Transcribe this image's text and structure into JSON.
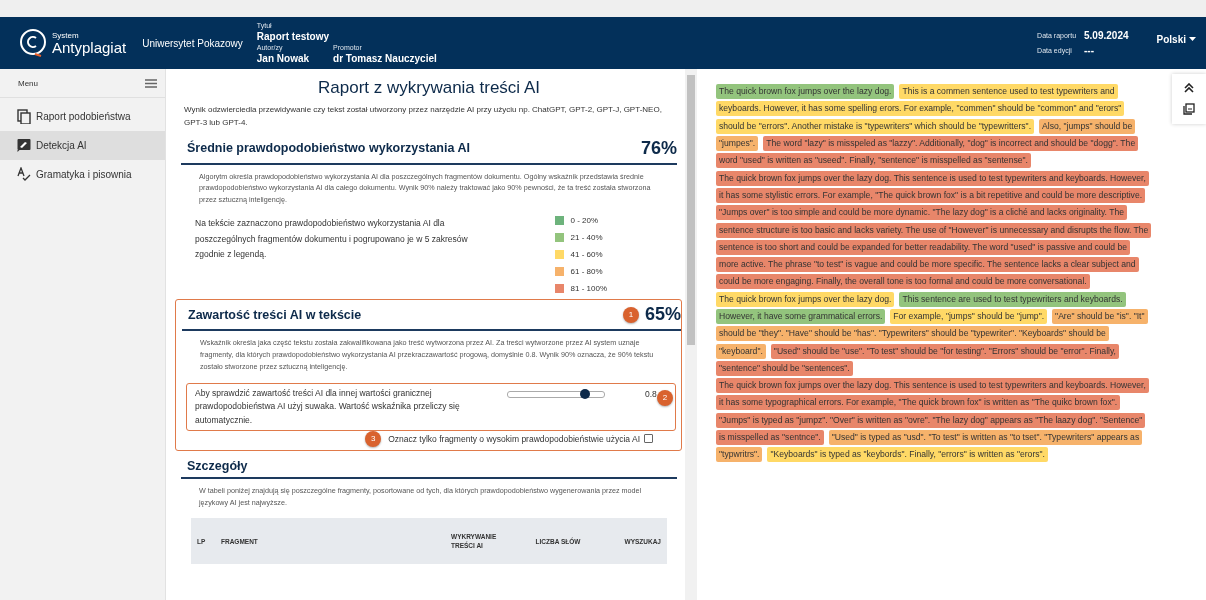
{
  "header": {
    "logo_small": "System",
    "logo": "Antyplagiat",
    "institution": "Uniwersytet Pokazowy",
    "title_label": "Tytuł",
    "title": "Raport testowy",
    "author_label": "Autor/zy",
    "author": "Jan Nowak",
    "promoter_label": "Promotor",
    "promoter": "dr Tomasz Nauczyciel",
    "report_date_label": "Data raportu",
    "report_date": "5.09.2024",
    "edit_date_label": "Data edycji",
    "edit_date": "---",
    "language": "Polski"
  },
  "sidebar": {
    "menu_label": "Menu",
    "items": [
      {
        "label": "Raport podobieństwa",
        "kind": "copy",
        "selected": false
      },
      {
        "label": "Detekcja AI",
        "kind": "ai",
        "selected": true
      },
      {
        "label": "Gramatyka i pisownia",
        "kind": "spell",
        "selected": false
      }
    ]
  },
  "report": {
    "title": "Raport z wykrywania treści AI",
    "intro": "Wynik odzwierciedla przewidywanie czy tekst został utworzony przez narzędzie AI przy użyciu np. ChatGPT, GPT-2, GPT-J, GPT-NEO, GPT-3 lub GPT-4.",
    "average": {
      "heading": "Średnie prawdopodobieństwo wykorzystania AI",
      "value": "76%",
      "description": "Algorytm określa prawdopodobieństwo wykorzystania AI dla poszczególnych fragmentów dokumentu. Ogólny wskaźnik przedstawia średnie prawdopodobieństwo wykorzystania AI dla całego dokumentu. Wynik 90% należy traktować jako 90% pewności, że ta treść została stworzona przez sztuczną inteligencję.",
      "legend_text": "Na tekście zaznaczono prawdopodobieństwo wykorzystania AI dla poszczególnych fragmentów dokumentu i pogrupowano je w 5 zakresów zgodnie z legendą.",
      "legend": [
        {
          "label": "0 - 20%",
          "color": "#6db37c"
        },
        {
          "label": "21 - 40%",
          "color": "#93c47d"
        },
        {
          "label": "41 - 60%",
          "color": "#ffd966"
        },
        {
          "label": "61 - 80%",
          "color": "#f6b26b"
        },
        {
          "label": "81 - 100%",
          "color": "#e8866a"
        }
      ]
    },
    "content": {
      "callout": "1",
      "heading": "Zawartość treści AI w tekście",
      "value": "65%",
      "description": "Wskaźnik określa jaka część tekstu została zakwalifikowana jako treść wytworzona przez AI. Za treści wytworzone przez AI system uznaje fragmenty, dla których prawdopodobieństwo wykorzystania AI przekraczawartość progową, domyślnie 0.8. Wynik 90% oznacza, że 90% tekstu zostało stworzone przez sztuczną inteligencję.",
      "slider": {
        "callout": "2",
        "text": "Aby sprawdzić zawartość treści AI dla innej wartości granicznej prawdopodobieństwa AI użyj suwaka. Wartość wskaźnika przeliczy się automatycznie.",
        "level": 0.8,
        "reading": "0.8"
      },
      "checkbox": {
        "callout": "3",
        "label": "Oznacz tylko fragmenty o wysokim prawdopodobieństwie użycia AI",
        "checked": false
      }
    },
    "details": {
      "heading": "Szczegóły",
      "description": "W tabeli poniżej znajdują się poszczególne fragmenty, posortowane od tych, dla których prawdopodobieństwo wygenerowania przez model językowy AI jest najwyższe.",
      "columns": [
        "LP",
        "FRAGMENT",
        "WYKRYWANIE TREŚCI AI",
        "LICZBA SŁÓW",
        "WYSZUKAJ"
      ]
    }
  },
  "document": {
    "lines": [
      {
        "fragments": [
          {
            "text": "The quick brown fox jumps over the lazy dog.",
            "color": "#93c47d"
          },
          {
            "text": "This is a commen sentence used to test typewriters and",
            "color": "#ffd966"
          }
        ]
      },
      {
        "fragments": [
          {
            "text": "keyboards. However, it has some spelling erors. For example, \"commen\" should be \"common\" and \"erors\"",
            "color": "#ffd966"
          }
        ]
      },
      {
        "fragments": [
          {
            "text": "should be \"errors\". Another mistake is \"typewriters\" which should be \"typewritters\".",
            "color": "#ffd966"
          },
          {
            "text": "Also, \"jumps\" should be",
            "color": "#f6b26b"
          }
        ]
      },
      {
        "fragments": [
          {
            "text": "\"jumpes\".",
            "color": "#f6b26b"
          },
          {
            "text": "The word \"lazy\" is misspeled as \"lazzy\". Additionally, \"dog\" is incorrect and should be \"dogg\". The",
            "color": "#e8866a"
          }
        ]
      },
      {
        "fragments": [
          {
            "text": "word \"used\" is written as \"useed\". Finally, \"sentence\" is misspelled as \"sentense\".",
            "color": "#e8866a"
          }
        ]
      },
      {
        "fragments": [
          {
            "text": "The quick brown fox jumps over the lazy dog. This sentence is used to test typewriters and keyboards. However,",
            "color": "#e8866a"
          }
        ]
      },
      {
        "fragments": [
          {
            "text": "it has some stylistic errors. For example, \"The quick brown fox\" is a bit repetitive and could be more descriptive.",
            "color": "#e8866a"
          }
        ]
      },
      {
        "fragments": [
          {
            "text": "\"Jumps over\" is too simple and could be more dynamic. \"The lazy dog\" is a cliché and lacks originality. The",
            "color": "#e8866a"
          }
        ]
      },
      {
        "fragments": [
          {
            "text": "sentence structure is too basic and lacks variety. The use of \"However\" is unnecessary and disrupts the flow. The",
            "color": "#e8866a"
          }
        ]
      },
      {
        "fragments": [
          {
            "text": "sentence is too short and could be expanded for better readability. The word \"used\" is passive and could be",
            "color": "#e8866a"
          }
        ]
      },
      {
        "fragments": [
          {
            "text": "more active. The phrase \"to test\" is vague and could be more specific. The sentence lacks a clear subject and",
            "color": "#e8866a"
          }
        ]
      },
      {
        "fragments": [
          {
            "text": "could be more engaging. Finally, the overall tone is too formal and could be more conversational.",
            "color": "#e8866a"
          }
        ]
      },
      {
        "fragments": [
          {
            "text": "The quick brown fox jumps over the lazy dog.",
            "color": "#ffd966"
          },
          {
            "text": "This sentence are used to test typewriters and keyboards.",
            "color": "#93c47d"
          }
        ]
      },
      {
        "fragments": [
          {
            "text": "However, it have some grammatical errors.",
            "color": "#93c47d"
          },
          {
            "text": "For example, \"jumps\" should be \"jump\".",
            "color": "#ffd966"
          },
          {
            "text": "\"Are\" should be \"is\". \"It\"",
            "color": "#f6b26b"
          }
        ]
      },
      {
        "fragments": [
          {
            "text": "should be \"they\". \"Have\" should be \"has\". \"Typewriters\" should be \"typewriter\". \"Keyboards\" should be",
            "color": "#f6b26b"
          }
        ]
      },
      {
        "fragments": [
          {
            "text": "\"keyboard\".",
            "color": "#f6b26b"
          },
          {
            "text": "\"Used\" should be \"use\". \"To test\" should be \"for testing\". \"Errors\" should be \"error\". Finally,",
            "color": "#e8866a"
          }
        ]
      },
      {
        "fragments": [
          {
            "text": "\"sentence\" should be \"sentences\".",
            "color": "#e8866a"
          }
        ]
      },
      {
        "fragments": [
          {
            "text": "The quick brown fox jumps over the lazy dog. This sentence is used to test typewriters and keyboards. However,",
            "color": "#e8866a"
          }
        ]
      },
      {
        "fragments": [
          {
            "text": "it has some typographical errors. For example, \"The quick brown fox\" is written as \"The quikc brown fox\".",
            "color": "#e8866a"
          }
        ]
      },
      {
        "fragments": [
          {
            "text": "\"Jumps\" is typed as \"jumpz\". \"Over\" is written as \"ovre\". \"The lazy dog\" appears as \"The laazy dog\". \"Sentence\"",
            "color": "#e8866a"
          }
        ]
      },
      {
        "fragments": [
          {
            "text": "is misspelled as \"sentnce\".",
            "color": "#e8866a"
          },
          {
            "text": "\"Used\" is typed as \"usd\". \"To test\" is written as \"to tset\". \"Typewriters\" appears as",
            "color": "#f6b26b"
          }
        ]
      },
      {
        "fragments": [
          {
            "text": "\"typwritrs\".",
            "color": "#f6b26b"
          },
          {
            "text": "\"Keyboards\" is typed as \"keybords\". Finally, \"errors\" is written as \"erors\".",
            "color": "#ffd966"
          }
        ]
      }
    ]
  }
}
